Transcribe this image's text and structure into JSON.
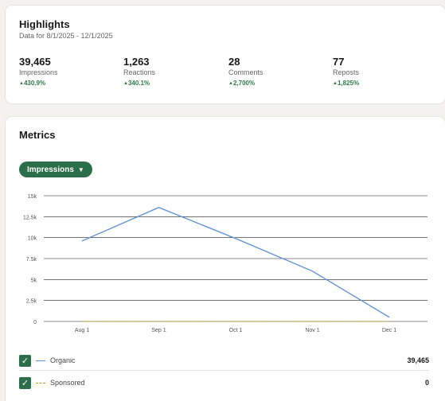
{
  "highlights": {
    "title": "Highlights",
    "subtitle": "Data for 8/1/2025 - 12/1/2025",
    "stats": [
      {
        "value": "39,465",
        "label": "Impressions",
        "change": "430.9%"
      },
      {
        "value": "1,263",
        "label": "Reactions",
        "change": "340.1%"
      },
      {
        "value": "28",
        "label": "Comments",
        "change": "2,700%"
      },
      {
        "value": "77",
        "label": "Reposts",
        "change": "1,825%"
      }
    ]
  },
  "metrics": {
    "title": "Metrics",
    "dropdown_label": "Impressions",
    "legend": [
      {
        "name": "Organic",
        "total": "39,465",
        "checked": true,
        "color": "#5b8fd6"
      },
      {
        "name": "Sponsored",
        "total": "0",
        "checked": true,
        "color": "#b4a21a"
      }
    ]
  },
  "chart_data": {
    "type": "line",
    "categories": [
      "Aug 1",
      "Sep 1",
      "Oct 1",
      "Nov 1",
      "Dec 1"
    ],
    "y_ticks": [
      "0",
      "2.5k",
      "5k",
      "7.5k",
      "10k",
      "12.5k",
      "15k"
    ],
    "ylim": [
      0,
      15000
    ],
    "grid": true,
    "series": [
      {
        "name": "Organic",
        "values": [
          9600,
          13600,
          9900,
          6000,
          500
        ],
        "style": "solid",
        "color": "#5b8fd6"
      },
      {
        "name": "Sponsored",
        "values": [
          0,
          0,
          0,
          0,
          0
        ],
        "style": "dashed",
        "color": "#b4a21a"
      }
    ]
  }
}
